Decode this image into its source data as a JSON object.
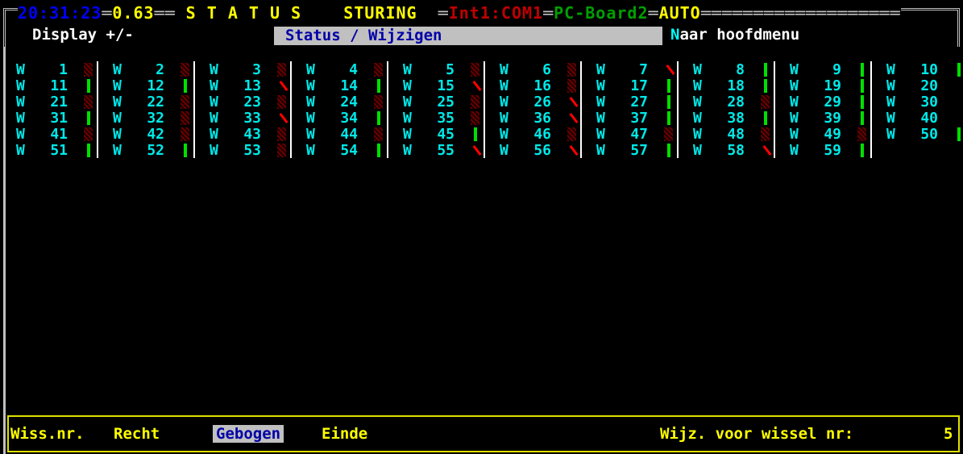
{
  "header": {
    "time": "20:31:23",
    "version": "0.63",
    "title": "S T A T U S",
    "mode": "STURING",
    "interface": "Int1:COM1",
    "board": "PC-Board2",
    "auto": "AUTO"
  },
  "menu": {
    "display_label": "Display +/-",
    "status_tab": "Status / Wijzigen",
    "main_menu_hotkey": "N",
    "main_menu_rest": "aar hoofdmenu"
  },
  "switches": [
    {
      "label": "W",
      "num": "1",
      "state": "gebogen"
    },
    {
      "label": "W",
      "num": "2",
      "state": "gebogen"
    },
    {
      "label": "W",
      "num": "3",
      "state": "gebogen"
    },
    {
      "label": "W",
      "num": "4",
      "state": "gebogen"
    },
    {
      "label": "W",
      "num": "5",
      "state": "gebogen"
    },
    {
      "label": "W",
      "num": "6",
      "state": "gebogen"
    },
    {
      "label": "W",
      "num": "7",
      "state": "rood"
    },
    {
      "label": "W",
      "num": "8",
      "state": "recht"
    },
    {
      "label": "W",
      "num": "9",
      "state": "recht"
    },
    {
      "label": "W",
      "num": "10",
      "state": "recht"
    },
    {
      "label": "W",
      "num": "11",
      "state": "recht"
    },
    {
      "label": "W",
      "num": "12",
      "state": "recht"
    },
    {
      "label": "W",
      "num": "13",
      "state": "rood"
    },
    {
      "label": "W",
      "num": "14",
      "state": "recht"
    },
    {
      "label": "W",
      "num": "15",
      "state": "rood"
    },
    {
      "label": "W",
      "num": "16",
      "state": "gebogen"
    },
    {
      "label": "W",
      "num": "17",
      "state": "recht"
    },
    {
      "label": "W",
      "num": "18",
      "state": "recht"
    },
    {
      "label": "W",
      "num": "19",
      "state": "recht"
    },
    {
      "label": "W",
      "num": "20",
      "state": ""
    },
    {
      "label": "W",
      "num": "21",
      "state": "gebogen"
    },
    {
      "label": "W",
      "num": "22",
      "state": "gebogen"
    },
    {
      "label": "W",
      "num": "23",
      "state": "gebogen"
    },
    {
      "label": "W",
      "num": "24",
      "state": "gebogen"
    },
    {
      "label": "W",
      "num": "25",
      "state": "gebogen"
    },
    {
      "label": "W",
      "num": "26",
      "state": "rood"
    },
    {
      "label": "W",
      "num": "27",
      "state": "recht"
    },
    {
      "label": "W",
      "num": "28",
      "state": "gebogen"
    },
    {
      "label": "W",
      "num": "29",
      "state": "recht"
    },
    {
      "label": "W",
      "num": "30",
      "state": ""
    },
    {
      "label": "W",
      "num": "31",
      "state": "recht"
    },
    {
      "label": "W",
      "num": "32",
      "state": "gebogen"
    },
    {
      "label": "W",
      "num": "33",
      "state": "rood"
    },
    {
      "label": "W",
      "num": "34",
      "state": "recht"
    },
    {
      "label": "W",
      "num": "35",
      "state": "gebogen"
    },
    {
      "label": "W",
      "num": "36",
      "state": "rood"
    },
    {
      "label": "W",
      "num": "37",
      "state": "recht"
    },
    {
      "label": "W",
      "num": "38",
      "state": "recht"
    },
    {
      "label": "W",
      "num": "39",
      "state": "recht"
    },
    {
      "label": "W",
      "num": "40",
      "state": ""
    },
    {
      "label": "W",
      "num": "41",
      "state": "gebogen"
    },
    {
      "label": "W",
      "num": "42",
      "state": "gebogen"
    },
    {
      "label": "W",
      "num": "43",
      "state": "gebogen"
    },
    {
      "label": "W",
      "num": "44",
      "state": "gebogen"
    },
    {
      "label": "W",
      "num": "45",
      "state": "recht"
    },
    {
      "label": "W",
      "num": "46",
      "state": "gebogen"
    },
    {
      "label": "W",
      "num": "47",
      "state": "gebogen"
    },
    {
      "label": "W",
      "num": "48",
      "state": "gebogen"
    },
    {
      "label": "W",
      "num": "49",
      "state": "gebogen"
    },
    {
      "label": "W",
      "num": "50",
      "state": "recht"
    },
    {
      "label": "W",
      "num": "51",
      "state": "recht"
    },
    {
      "label": "W",
      "num": "52",
      "state": "recht"
    },
    {
      "label": "W",
      "num": "53",
      "state": "gebogen"
    },
    {
      "label": "W",
      "num": "54",
      "state": "recht"
    },
    {
      "label": "W",
      "num": "55",
      "state": "rood"
    },
    {
      "label": "W",
      "num": "56",
      "state": "rood"
    },
    {
      "label": "W",
      "num": "57",
      "state": "recht"
    },
    {
      "label": "W",
      "num": "58",
      "state": "rood"
    },
    {
      "label": "W",
      "num": "59",
      "state": "recht"
    }
  ],
  "footer": {
    "wissnr": "Wiss.nr.",
    "recht": "Recht",
    "gebogen": "Gebogen",
    "einde": "Einde",
    "prompt": "Wijz. voor wissel nr:",
    "value": "5"
  },
  "colors": {
    "recht": "#00e000",
    "gebogen": "#6a0000",
    "rood": "#ff0000",
    "text": "#00e8e8",
    "highlight": "#c0c0c0"
  }
}
